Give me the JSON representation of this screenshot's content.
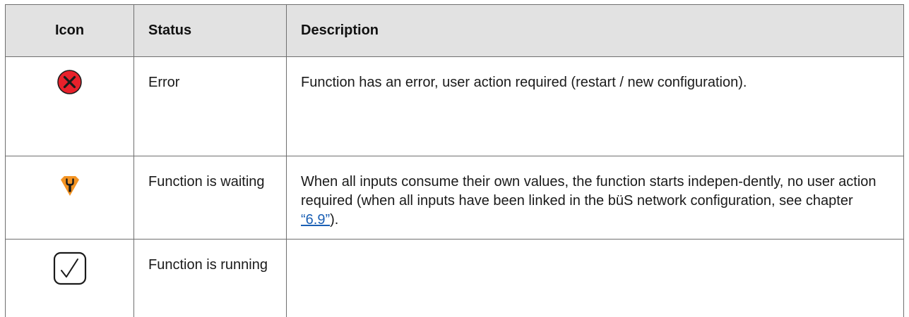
{
  "header": {
    "icon": "Icon",
    "status": "Status",
    "description": "Description"
  },
  "rows": [
    {
      "icon": "error-x-icon",
      "status": "Error",
      "description": "Function has an error, user action required (restart / new configuration)."
    },
    {
      "icon": "wrench-pentagon-icon",
      "status": "Function is waiting",
      "description_before": "When all inputs consume their own values, the function starts indepen-dently, no user action required (when all inputs have been linked in the büS network configuration, see chapter ",
      "link_text": "“6.9”",
      "description_after": ")."
    },
    {
      "icon": "checkbox-check-icon",
      "status": "Function is running",
      "description": ""
    }
  ],
  "colors": {
    "error": "#e8212b",
    "waiting": "#f39322",
    "header_bg": "#e2e2e2",
    "border": "#6f6f6f",
    "link": "#1a5fb4"
  }
}
